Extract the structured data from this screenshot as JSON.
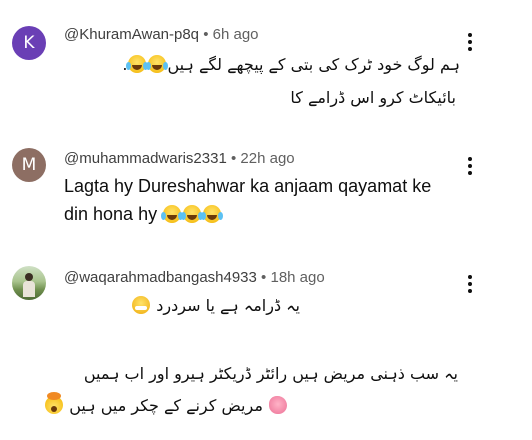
{
  "comments": [
    {
      "avatar_letter": "K",
      "avatar_color": "#6a3fb5",
      "handle": "@KhuramAwan-p8q",
      "time": "6h ago",
      "lines": [
        "ہم لوگ خود ٹرک کی بتی کے پیچھے لگے ہیں",
        "بائیکاٹ کرو اس ڈرامے کا"
      ],
      "emojis": [
        "face-with-tears-of-joy",
        "face-with-tears-of-joy",
        "face-with-tears-of-joy"
      ],
      "line1_suffix": "."
    },
    {
      "avatar_letter": "M",
      "avatar_color": "#8d6e63",
      "handle": "@muhammadwaris2331",
      "time": "22h ago",
      "lines": [
        "Lagta hy Dureshahwar ka anjaam qayamat ke",
        "din hona hy"
      ],
      "emojis": [
        "face-with-tears-of-joy",
        "face-with-tears-of-joy",
        "face-with-tears-of-joy"
      ]
    },
    {
      "avatar_kind": "photo",
      "handle": "@waqarahmadbangash4933",
      "time": "18h ago",
      "lines": [
        "یہ ڈرامہ ہے یا سردرد",
        "یہ سب ذہنی مریض ہیں رائٹر ڈریکٹر ہیرو اور اب ہمیں",
        "مریض کرنے کے چکر میں ہیں"
      ],
      "emojis": [
        "face-vomiting",
        "brain",
        "exploding-head"
      ]
    }
  ],
  "separator": "•"
}
